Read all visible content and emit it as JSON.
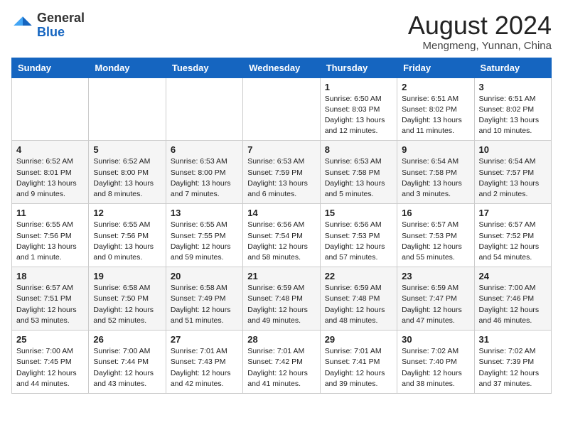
{
  "header": {
    "logo_general": "General",
    "logo_blue": "Blue",
    "month_title": "August 2024",
    "location": "Mengmeng, Yunnan, China"
  },
  "weekdays": [
    "Sunday",
    "Monday",
    "Tuesday",
    "Wednesday",
    "Thursday",
    "Friday",
    "Saturday"
  ],
  "weeks": [
    [
      {
        "day": "",
        "info": ""
      },
      {
        "day": "",
        "info": ""
      },
      {
        "day": "",
        "info": ""
      },
      {
        "day": "",
        "info": ""
      },
      {
        "day": "1",
        "info": "Sunrise: 6:50 AM\nSunset: 8:03 PM\nDaylight: 13 hours\nand 12 minutes."
      },
      {
        "day": "2",
        "info": "Sunrise: 6:51 AM\nSunset: 8:02 PM\nDaylight: 13 hours\nand 11 minutes."
      },
      {
        "day": "3",
        "info": "Sunrise: 6:51 AM\nSunset: 8:02 PM\nDaylight: 13 hours\nand 10 minutes."
      }
    ],
    [
      {
        "day": "4",
        "info": "Sunrise: 6:52 AM\nSunset: 8:01 PM\nDaylight: 13 hours\nand 9 minutes."
      },
      {
        "day": "5",
        "info": "Sunrise: 6:52 AM\nSunset: 8:00 PM\nDaylight: 13 hours\nand 8 minutes."
      },
      {
        "day": "6",
        "info": "Sunrise: 6:53 AM\nSunset: 8:00 PM\nDaylight: 13 hours\nand 7 minutes."
      },
      {
        "day": "7",
        "info": "Sunrise: 6:53 AM\nSunset: 7:59 PM\nDaylight: 13 hours\nand 6 minutes."
      },
      {
        "day": "8",
        "info": "Sunrise: 6:53 AM\nSunset: 7:58 PM\nDaylight: 13 hours\nand 5 minutes."
      },
      {
        "day": "9",
        "info": "Sunrise: 6:54 AM\nSunset: 7:58 PM\nDaylight: 13 hours\nand 3 minutes."
      },
      {
        "day": "10",
        "info": "Sunrise: 6:54 AM\nSunset: 7:57 PM\nDaylight: 13 hours\nand 2 minutes."
      }
    ],
    [
      {
        "day": "11",
        "info": "Sunrise: 6:55 AM\nSunset: 7:56 PM\nDaylight: 13 hours\nand 1 minute."
      },
      {
        "day": "12",
        "info": "Sunrise: 6:55 AM\nSunset: 7:56 PM\nDaylight: 13 hours\nand 0 minutes."
      },
      {
        "day": "13",
        "info": "Sunrise: 6:55 AM\nSunset: 7:55 PM\nDaylight: 12 hours\nand 59 minutes."
      },
      {
        "day": "14",
        "info": "Sunrise: 6:56 AM\nSunset: 7:54 PM\nDaylight: 12 hours\nand 58 minutes."
      },
      {
        "day": "15",
        "info": "Sunrise: 6:56 AM\nSunset: 7:53 PM\nDaylight: 12 hours\nand 57 minutes."
      },
      {
        "day": "16",
        "info": "Sunrise: 6:57 AM\nSunset: 7:53 PM\nDaylight: 12 hours\nand 55 minutes."
      },
      {
        "day": "17",
        "info": "Sunrise: 6:57 AM\nSunset: 7:52 PM\nDaylight: 12 hours\nand 54 minutes."
      }
    ],
    [
      {
        "day": "18",
        "info": "Sunrise: 6:57 AM\nSunset: 7:51 PM\nDaylight: 12 hours\nand 53 minutes."
      },
      {
        "day": "19",
        "info": "Sunrise: 6:58 AM\nSunset: 7:50 PM\nDaylight: 12 hours\nand 52 minutes."
      },
      {
        "day": "20",
        "info": "Sunrise: 6:58 AM\nSunset: 7:49 PM\nDaylight: 12 hours\nand 51 minutes."
      },
      {
        "day": "21",
        "info": "Sunrise: 6:59 AM\nSunset: 7:48 PM\nDaylight: 12 hours\nand 49 minutes."
      },
      {
        "day": "22",
        "info": "Sunrise: 6:59 AM\nSunset: 7:48 PM\nDaylight: 12 hours\nand 48 minutes."
      },
      {
        "day": "23",
        "info": "Sunrise: 6:59 AM\nSunset: 7:47 PM\nDaylight: 12 hours\nand 47 minutes."
      },
      {
        "day": "24",
        "info": "Sunrise: 7:00 AM\nSunset: 7:46 PM\nDaylight: 12 hours\nand 46 minutes."
      }
    ],
    [
      {
        "day": "25",
        "info": "Sunrise: 7:00 AM\nSunset: 7:45 PM\nDaylight: 12 hours\nand 44 minutes."
      },
      {
        "day": "26",
        "info": "Sunrise: 7:00 AM\nSunset: 7:44 PM\nDaylight: 12 hours\nand 43 minutes."
      },
      {
        "day": "27",
        "info": "Sunrise: 7:01 AM\nSunset: 7:43 PM\nDaylight: 12 hours\nand 42 minutes."
      },
      {
        "day": "28",
        "info": "Sunrise: 7:01 AM\nSunset: 7:42 PM\nDaylight: 12 hours\nand 41 minutes."
      },
      {
        "day": "29",
        "info": "Sunrise: 7:01 AM\nSunset: 7:41 PM\nDaylight: 12 hours\nand 39 minutes."
      },
      {
        "day": "30",
        "info": "Sunrise: 7:02 AM\nSunset: 7:40 PM\nDaylight: 12 hours\nand 38 minutes."
      },
      {
        "day": "31",
        "info": "Sunrise: 7:02 AM\nSunset: 7:39 PM\nDaylight: 12 hours\nand 37 minutes."
      }
    ]
  ]
}
